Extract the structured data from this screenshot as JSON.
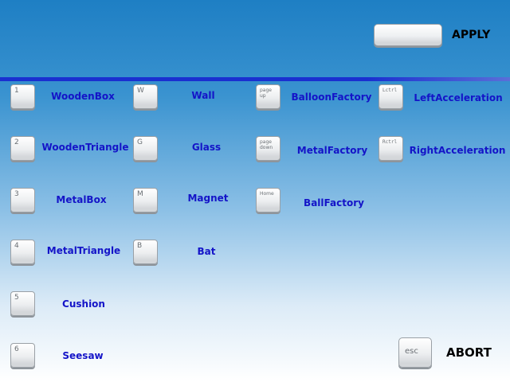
{
  "toolbar": {
    "apply_label": "APPLY",
    "abort_label": "ABORT",
    "esc_key": "esc"
  },
  "columns": [
    {
      "items": [
        {
          "key": "1",
          "label": "WoodenBox"
        },
        {
          "key": "2",
          "label": "WoodenTriangle"
        },
        {
          "key": "3",
          "label": "MetalBox"
        },
        {
          "key": "4",
          "label": "MetalTriangle"
        },
        {
          "key": "5",
          "label": "Cushion"
        },
        {
          "key": "6",
          "label": "Seesaw"
        }
      ]
    },
    {
      "items": [
        {
          "key": "W",
          "label": "Wall"
        },
        {
          "key": "G",
          "label": "Glass"
        },
        {
          "key": "M",
          "label": "Magnet"
        },
        {
          "key": "B",
          "label": "Bat"
        }
      ]
    },
    {
      "items": [
        {
          "key": "page\nup",
          "label": "BalloonFactory"
        },
        {
          "key": "page\ndown",
          "label": "MetalFactory"
        },
        {
          "key": "Home",
          "label": "BallFactory"
        }
      ]
    },
    {
      "items": [
        {
          "key": "Lctrl",
          "label": "LeftAcceleration"
        },
        {
          "key": "Rctrl",
          "label": "RightAcceleration"
        }
      ]
    }
  ],
  "colors": {
    "label": "#1414c8",
    "divider": "#1a2fd0",
    "bg_top": "#1e7fc4",
    "bg_bottom": "#ffffff"
  }
}
